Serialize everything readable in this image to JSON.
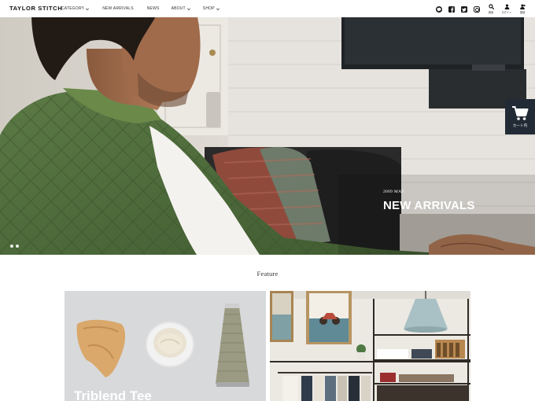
{
  "brand": {
    "logo_text": "TAYLOR STITCH"
  },
  "nav": {
    "items": [
      {
        "label": "CATEGORY",
        "has_dropdown": true
      },
      {
        "label": "NEW ARRIVALS",
        "has_dropdown": false
      },
      {
        "label": "NEWS",
        "has_dropdown": false
      },
      {
        "label": "ABOUT",
        "has_dropdown": true
      },
      {
        "label": "SHOP",
        "has_dropdown": true
      }
    ]
  },
  "social_icons": [
    "line-icon",
    "facebook-icon",
    "twitter-icon",
    "instagram-icon"
  ],
  "utility": {
    "search_label": "検索",
    "login_label": "ログイン",
    "register_label": "登録"
  },
  "hero": {
    "date": "2009 MAY",
    "title": "NEW ARRIVALS",
    "slide_count": 2
  },
  "cart_tab": {
    "label": "カート内"
  },
  "feature": {
    "section_title": "Feature",
    "cards": [
      {
        "label": "Triblend Tee"
      },
      {
        "label": ""
      }
    ]
  },
  "colors": {
    "header_bg": "#ffffff",
    "cart_tab_bg": "#222b35",
    "hero_text": "#ffffff",
    "jacket_green": "#4b6b3a"
  }
}
